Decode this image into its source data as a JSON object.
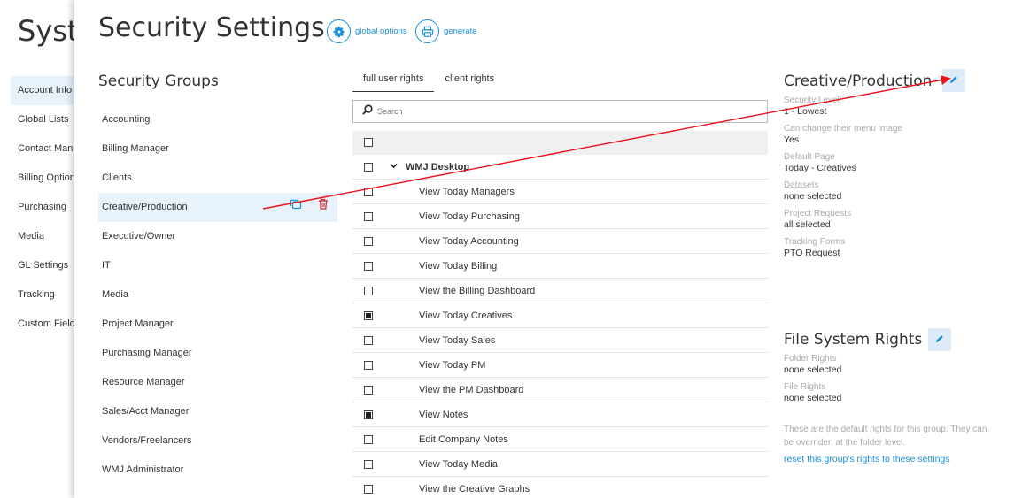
{
  "background": {
    "title": "Syste",
    "nav": [
      "Account Info",
      "Global Lists",
      "Contact Man",
      "Billing Option",
      "Purchasing",
      "Media",
      "GL Settings",
      "Tracking",
      "Custom Field"
    ]
  },
  "header": {
    "title": "Security Settings",
    "global_options": "global options",
    "generate": "generate"
  },
  "groups": {
    "title": "Security Groups",
    "items": [
      "Accounting",
      "Billing Manager",
      "Clients",
      "Creative/Production",
      "Executive/Owner",
      "IT",
      "Media",
      "Project Manager",
      "Purchasing Manager",
      "Resource Manager",
      "Sales/Acct Manager",
      "Vendors/Freelancers",
      "WMJ Administrator"
    ],
    "selected": "Creative/Production"
  },
  "rights": {
    "tabs": [
      "full user rights",
      "client rights"
    ],
    "active_tab": "full user rights",
    "search_placeholder": "Search",
    "group_name": "WMJ Desktop",
    "rows": [
      {
        "label": "View Today Managers",
        "checked": false
      },
      {
        "label": "View Today Purchasing",
        "checked": false
      },
      {
        "label": "View Today Accounting",
        "checked": false
      },
      {
        "label": "View Today Billing",
        "checked": false
      },
      {
        "label": "View the Billing Dashboard",
        "checked": false
      },
      {
        "label": "View Today Creatives",
        "checked": true
      },
      {
        "label": "View Today Sales",
        "checked": false
      },
      {
        "label": "View Today PM",
        "checked": false
      },
      {
        "label": "View the PM Dashboard",
        "checked": false
      },
      {
        "label": "View Notes",
        "checked": true
      },
      {
        "label": "Edit Company Notes",
        "checked": false
      },
      {
        "label": "View Today Media",
        "checked": false
      },
      {
        "label": "View the Creative Graphs",
        "checked": false
      }
    ]
  },
  "detail": {
    "title": "Creative/Production",
    "fields": [
      {
        "label": "Security Level",
        "value": "1 - Lowest"
      },
      {
        "label": "Can change their menu image",
        "value": "Yes"
      },
      {
        "label": "Default Page",
        "value": "Today - Creatives"
      },
      {
        "label": "Datasets",
        "value": "none selected"
      },
      {
        "label": "Project Requests",
        "value": "all selected"
      },
      {
        "label": "Tracking Forms",
        "value": "PTO Request"
      }
    ]
  },
  "file_system": {
    "title": "File System Rights",
    "fields": [
      {
        "label": "Folder Rights",
        "value": "none selected"
      },
      {
        "label": "File Rights",
        "value": "none selected"
      }
    ],
    "note": "These are the default rights for this group. They can be overriden at the folder level.",
    "reset_link": "reset this group's rights to these settings"
  },
  "colors": {
    "accent": "#1a8fd6",
    "selected_bg": "#e8f2fb",
    "annotation": "#e8141b"
  },
  "icons": [
    "gear-icon",
    "printer-icon",
    "search-icon",
    "copy-icon",
    "trash-icon",
    "pencil-icon",
    "chevron-down-icon"
  ]
}
